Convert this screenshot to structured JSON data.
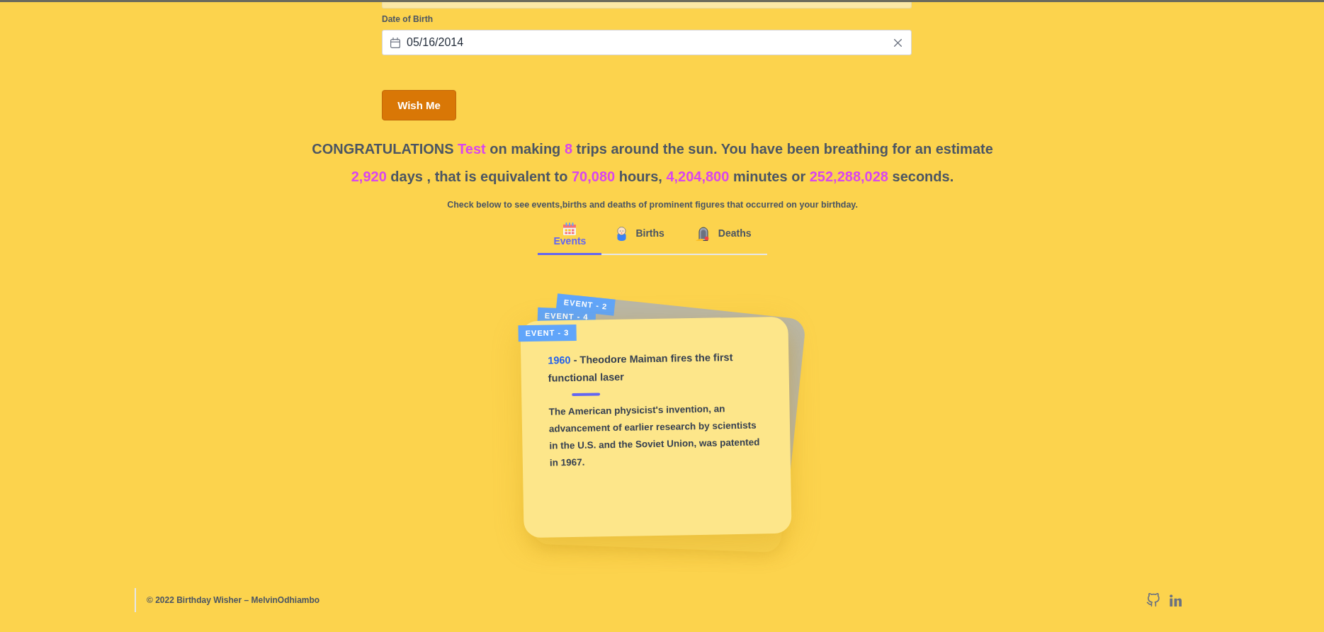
{
  "form": {
    "date_field": {
      "label": "Date of Birth",
      "value": "05/16/2014"
    },
    "submit_button": {
      "label": "Wish Me"
    }
  },
  "message": {
    "segments": [
      {
        "text": "CONGRATULATIONS ",
        "highlight": false
      },
      {
        "text": "Test",
        "highlight": true
      },
      {
        "text": " on making ",
        "highlight": false
      },
      {
        "text": "8",
        "highlight": true
      },
      {
        "text": " trips around the sun. You have been breathing for an estimate ",
        "highlight": false
      },
      {
        "text": "2,920",
        "highlight": true
      },
      {
        "text": " days , that is equivalent to ",
        "highlight": false
      },
      {
        "text": "70,080",
        "highlight": true
      },
      {
        "text": " hours, ",
        "highlight": false
      },
      {
        "text": "4,204,800",
        "highlight": true
      },
      {
        "text": " minutes or ",
        "highlight": false
      },
      {
        "text": "252,288,028",
        "highlight": true
      },
      {
        "text": " seconds.",
        "highlight": false
      }
    ]
  },
  "hint": "Check below to see events,births and deaths of prominent figures that occurred on your birthday.",
  "tabs": [
    {
      "kind": "events",
      "label": "Events",
      "selected": true
    },
    {
      "kind": "births",
      "label": "Births",
      "selected": false
    },
    {
      "kind": "deaths",
      "label": "Deaths",
      "selected": false
    }
  ],
  "event_cards": [
    {
      "tag": "EVENT - 2"
    },
    {
      "tag": "EVENT - 4"
    },
    {
      "tag": "EVENT - 3",
      "year": "1960",
      "headline": "- Theodore Maiman fires the first functional laser",
      "description": "The American physicist's invention, an advancement of earlier research by scientists in the U.S. and the Soviet Union, was patented in 1967."
    }
  ],
  "footer": {
    "copyright": "© 2022 Birthday Wisher – MelvinOdhiambo",
    "links": [
      {
        "kind": "github"
      },
      {
        "kind": "linkedin"
      }
    ]
  }
}
